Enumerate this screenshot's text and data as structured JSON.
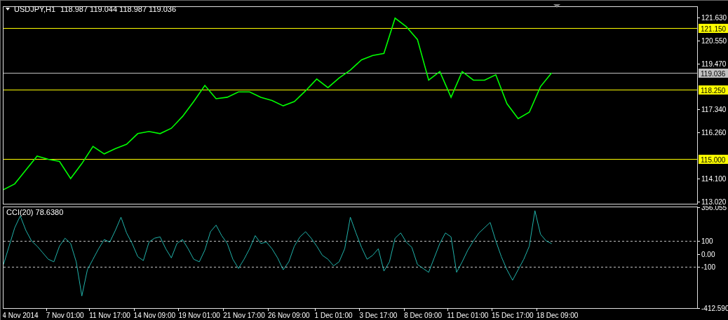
{
  "main_panel": {
    "symbol": "USDJPY,H1",
    "quote": "118.987 119.044 118.987 119.036",
    "chart_data": {
      "type": "line",
      "ylim": [
        112.92,
        122.12
      ],
      "categories": [
        null,
        null,
        null,
        null,
        null,
        null,
        null,
        null,
        null,
        null,
        null,
        null,
        null,
        null,
        null,
        null,
        null,
        null,
        null,
        null,
        null,
        null,
        null,
        null,
        null,
        null,
        null,
        null,
        null,
        null,
        null,
        null,
        null,
        null,
        null,
        null,
        null,
        null,
        null,
        null,
        null,
        null,
        null,
        null,
        null,
        null,
        null,
        null,
        null,
        null,
        null,
        null,
        null,
        null,
        null,
        null,
        null,
        null,
        null,
        null,
        null,
        null
      ],
      "series": [
        {
          "color": "#00ff00",
          "values": [
            113.58,
            113.85,
            114.5,
            115.15,
            115.0,
            114.9,
            114.1,
            114.8,
            115.6,
            115.25,
            115.5,
            115.7,
            116.2,
            116.3,
            116.2,
            116.45,
            117.0,
            117.7,
            118.45,
            117.83,
            117.9,
            118.15,
            118.15,
            117.9,
            117.75,
            117.5,
            117.7,
            118.2,
            118.75,
            118.35,
            118.8,
            119.17,
            119.65,
            119.85,
            119.95,
            121.6,
            121.2,
            120.6,
            118.7,
            119.1,
            117.9,
            119.1,
            118.7,
            118.7,
            118.95,
            117.6,
            116.9,
            117.2,
            118.4,
            119.04,
            null,
            null,
            null,
            null,
            null,
            null,
            null,
            null,
            null,
            null,
            null,
            null
          ]
        }
      ],
      "yticks": [
        {
          "value": 121.63,
          "label": "121.630"
        },
        {
          "value": 120.55,
          "label": "120.550"
        },
        {
          "value": 119.47,
          "label": "119.470"
        },
        {
          "value": 117.34,
          "label": "117.340"
        },
        {
          "value": 116.26,
          "label": "116.260"
        },
        {
          "value": 114.1,
          "label": "114.100"
        },
        {
          "value": 113.02,
          "label": "113.020"
        }
      ],
      "ref_lines": [
        {
          "axis": "y",
          "value": 121.15,
          "label": "121.150",
          "color": "#ffff00"
        },
        {
          "axis": "y",
          "value": 119.036,
          "label": "119.036",
          "color": "#c0c0c0"
        },
        {
          "axis": "y",
          "value": 118.25,
          "label": "118.250",
          "color": "#ffff00"
        },
        {
          "axis": "y",
          "value": 115.0,
          "label": "115.000",
          "color": "#ffff00"
        }
      ]
    }
  },
  "indicator_panel": {
    "label": "CCI(20) 78.6380",
    "chart_data": {
      "type": "line",
      "ylim": [
        -412.5903,
        356.055
      ],
      "categories": [
        null,
        null,
        null,
        "4 Nov 2014",
        null,
        null,
        null,
        null,
        null,
        null,
        null,
        "7 Nov 01:00",
        null,
        null,
        null,
        null,
        null,
        null,
        null,
        "11 Nov 17:00",
        null,
        null,
        null,
        null,
        null,
        null,
        null,
        "14 Nov 09:00",
        null,
        null,
        null,
        null,
        null,
        null,
        null,
        "19 Nov 01:00",
        null,
        null,
        null,
        null,
        null,
        null,
        null,
        "21 Nov 17:00",
        null,
        null,
        null,
        null,
        null,
        null,
        null,
        "26 Nov 09:00",
        null,
        null,
        null,
        null,
        null,
        null,
        null,
        "1 Dec 01:00",
        null,
        null,
        null,
        null,
        null,
        null,
        null,
        "3 Dec 17:00",
        null,
        null,
        null,
        null,
        null,
        null,
        null,
        "8 Dec 09:00",
        null,
        null,
        null,
        null,
        null,
        null,
        null,
        "11 Dec 01:00",
        null,
        null,
        null,
        null,
        null,
        null,
        null,
        "15 Dec 17:00",
        null,
        null,
        null,
        null,
        null,
        null,
        null,
        "18 Dec 09:00",
        null,
        null,
        null,
        null,
        null,
        null,
        null,
        null,
        null,
        null,
        null,
        null,
        null,
        null,
        null,
        null,
        null,
        null,
        null,
        null,
        null,
        null,
        null,
        null
      ],
      "series": [
        {
          "color": "#20b2aa",
          "values": [
            -80,
            60,
            200,
            290,
            180,
            100,
            60,
            10,
            -40,
            -60,
            60,
            120,
            80,
            -60,
            -320,
            -120,
            -40,
            40,
            110,
            90,
            180,
            280,
            160,
            80,
            -20,
            -50,
            90,
            120,
            130,
            40,
            -30,
            80,
            110,
            40,
            -40,
            -60,
            30,
            170,
            220,
            140,
            80,
            -40,
            -110,
            -40,
            40,
            140,
            80,
            90,
            40,
            -30,
            -120,
            -60,
            60,
            130,
            170,
            120,
            60,
            -10,
            -40,
            -90,
            -60,
            40,
            280,
            160,
            50,
            -40,
            -10,
            40,
            -130,
            -60,
            120,
            160,
            90,
            50,
            -80,
            -110,
            -140,
            -30,
            80,
            160,
            130,
            -140,
            -60,
            30,
            100,
            160,
            200,
            240,
            100,
            -20,
            -120,
            -200,
            -120,
            -40,
            60,
            330,
            150,
            100,
            79,
            null,
            null,
            null,
            null,
            null,
            null,
            null,
            null,
            null,
            null,
            null,
            null,
            null,
            null,
            null,
            null,
            null,
            null,
            null,
            null,
            null,
            null,
            null,
            null,
            null
          ]
        }
      ],
      "yticks": [
        {
          "value": 356.055,
          "label": "356.055"
        },
        {
          "value": 100,
          "label": "100"
        },
        {
          "value": 0,
          "label": "0.00"
        },
        {
          "value": -100,
          "label": "-100"
        },
        {
          "value": -412.5903,
          "label": "-412.590"
        }
      ],
      "ref_lines": [
        {
          "axis": "y",
          "value": 100,
          "color": "#c0c0c0"
        },
        {
          "axis": "y",
          "value": -100,
          "color": "#c0c0c0"
        }
      ]
    }
  }
}
